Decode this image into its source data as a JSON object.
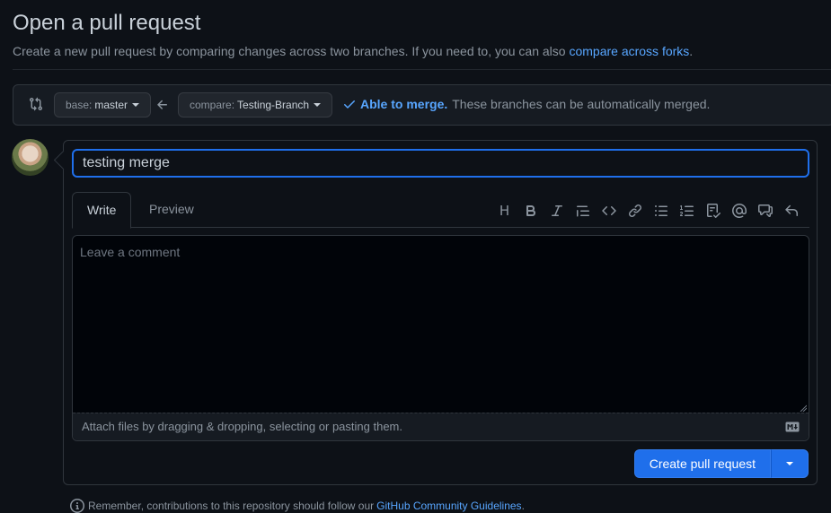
{
  "page": {
    "title": "Open a pull request",
    "subtitle": "Create a new pull request by comparing changes across two branches. If you need to, you can also",
    "compare_forks_link": "compare across forks",
    "subtitle_end": "."
  },
  "range": {
    "base_prefix": "base:",
    "base_branch": "master",
    "compare_prefix": "compare:",
    "compare_branch": "Testing-Branch",
    "merge_ok": "Able to merge.",
    "merge_detail": "These branches can be automatically merged."
  },
  "composer": {
    "title_value": "testing merge",
    "tabs": [
      {
        "label": "Write",
        "active": true
      },
      {
        "label": "Preview",
        "active": false
      }
    ],
    "toolbar_icons": [
      "heading-icon",
      "bold-icon",
      "italic-icon",
      "quote-icon",
      "code-icon",
      "link-icon",
      "bullet-list-icon",
      "numbered-list-icon",
      "task-list-icon",
      "mention-icon",
      "cross-reference-icon",
      "reply-icon"
    ],
    "comment_placeholder": "Leave a comment",
    "attach_hint": "Attach files by dragging & dropping, selecting or pasting them.",
    "create_button": "Create pull request"
  },
  "footer": {
    "remember_text": "Remember, contributions to this repository should follow our",
    "guidelines_link": "GitHub Community Guidelines",
    "guidelines_end": "."
  },
  "colors": {
    "background": "#0d1117",
    "accent": "#1f6feb",
    "link": "#58a6ff",
    "border": "#30363d"
  }
}
